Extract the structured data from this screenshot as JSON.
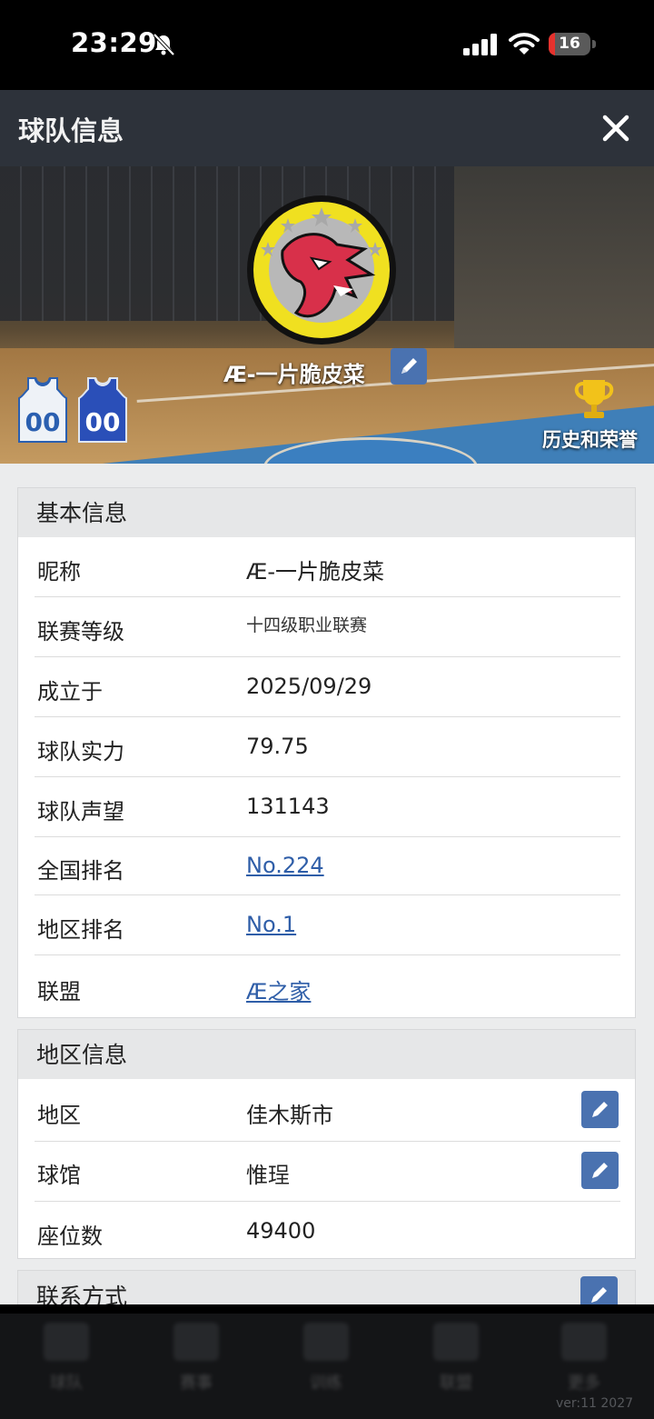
{
  "status_bar": {
    "time": "23:29",
    "battery": "16",
    "battery_level": 0.16
  },
  "header": {
    "title": "球队信息"
  },
  "banner": {
    "team_name": "Æ-一片脆皮菜",
    "jersey_number_home": "00",
    "jersey_number_away": "00",
    "history_label": "历史和荣誉"
  },
  "basic_info": {
    "title": "基本信息",
    "rows": [
      {
        "label": "昵称",
        "value": "Æ-一片脆皮菜"
      },
      {
        "label": "联赛等级",
        "value": "十四级职业联赛"
      },
      {
        "label": "成立于",
        "value": "2025/09/29"
      },
      {
        "label": "球队实力",
        "value": "79.75"
      },
      {
        "label": "球队声望",
        "value": "131143"
      },
      {
        "label": "全国排名",
        "value": "No.224"
      },
      {
        "label": "地区排名",
        "value": "No.1"
      },
      {
        "label": "联盟",
        "value": "Æ之家"
      }
    ]
  },
  "region_info": {
    "title": "地区信息",
    "rows": [
      {
        "label": "地区",
        "value": "佳木斯市"
      },
      {
        "label": "球馆",
        "value": "惟珵"
      },
      {
        "label": "座位数",
        "value": "49400"
      }
    ]
  },
  "contact": {
    "title": "联系方式"
  },
  "bottom_nav": {
    "items": [
      "球队",
      "赛事",
      "训练",
      "联盟",
      "更多"
    ],
    "version": "ver:11  2027"
  },
  "colors": {
    "header_bg": "#2d323a",
    "link": "#2f5ea8",
    "edit_button": "#4a72b0",
    "battery_low": "#e5322d"
  }
}
